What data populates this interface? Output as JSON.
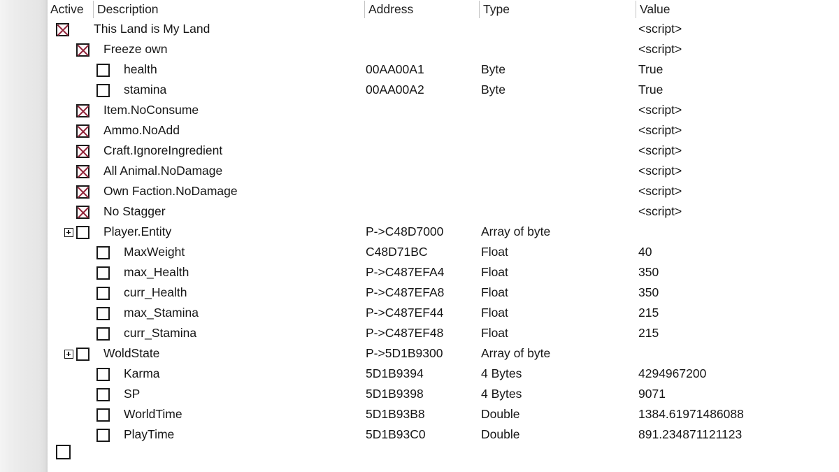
{
  "window": {
    "title": "Cheat Engine Table"
  },
  "columns": {
    "active": "Active",
    "description": "Description",
    "address": "Address",
    "type": "Type",
    "value": "Value"
  },
  "colors": {
    "check_mark": "#8e2036",
    "box_border": "#1a1a1a",
    "text": "#161616",
    "header_divider": "#c4c4c4",
    "background": "#ffffff",
    "gutter": "#e9e9e9"
  },
  "rows": [
    {
      "indent": 0,
      "checked": true,
      "expander": false,
      "description": "This Land is My Land",
      "address": "",
      "type": "",
      "value": "<script>"
    },
    {
      "indent": 1,
      "checked": true,
      "expander": false,
      "description": "Freeze own",
      "address": "",
      "type": "",
      "value": "<script>"
    },
    {
      "indent": 2,
      "checked": false,
      "expander": false,
      "description": "health",
      "address": "00AA00A1",
      "type": "Byte",
      "value": "True"
    },
    {
      "indent": 2,
      "checked": false,
      "expander": false,
      "description": "stamina",
      "address": "00AA00A2",
      "type": "Byte",
      "value": "True"
    },
    {
      "indent": 1,
      "checked": true,
      "expander": false,
      "description": "Item.NoConsume",
      "address": "",
      "type": "",
      "value": "<script>"
    },
    {
      "indent": 1,
      "checked": true,
      "expander": false,
      "description": "Ammo.NoAdd",
      "address": "",
      "type": "",
      "value": "<script>"
    },
    {
      "indent": 1,
      "checked": true,
      "expander": false,
      "description": "Craft.IgnoreIngredient",
      "address": "",
      "type": "",
      "value": "<script>"
    },
    {
      "indent": 1,
      "checked": true,
      "expander": false,
      "description": "All Animal.NoDamage",
      "address": "",
      "type": "",
      "value": "<script>"
    },
    {
      "indent": 1,
      "checked": true,
      "expander": false,
      "description": "Own Faction.NoDamage",
      "address": "",
      "type": "",
      "value": "<script>"
    },
    {
      "indent": 1,
      "checked": true,
      "expander": false,
      "description": "No Stagger",
      "address": "",
      "type": "",
      "value": "<script>"
    },
    {
      "indent": 1,
      "checked": false,
      "expander": true,
      "description": "Player.Entity",
      "address": "P->C48D7000",
      "type": "Array of byte",
      "value": ""
    },
    {
      "indent": 2,
      "checked": false,
      "expander": false,
      "description": "MaxWeight",
      "address": "C48D71BC",
      "type": "Float",
      "value": "40"
    },
    {
      "indent": 2,
      "checked": false,
      "expander": false,
      "description": "max_Health",
      "address": "P->C487EFA4",
      "type": "Float",
      "value": "350"
    },
    {
      "indent": 2,
      "checked": false,
      "expander": false,
      "description": "curr_Health",
      "address": "P->C487EFA8",
      "type": "Float",
      "value": "350"
    },
    {
      "indent": 2,
      "checked": false,
      "expander": false,
      "description": "max_Stamina",
      "address": "P->C487EF44",
      "type": "Float",
      "value": "215"
    },
    {
      "indent": 2,
      "checked": false,
      "expander": false,
      "description": "curr_Stamina",
      "address": "P->C487EF48",
      "type": "Float",
      "value": "215"
    },
    {
      "indent": 1,
      "checked": false,
      "expander": true,
      "description": "WoldState",
      "address": "P->5D1B9300",
      "type": "Array of byte",
      "value": ""
    },
    {
      "indent": 2,
      "checked": false,
      "expander": false,
      "description": "Karma",
      "address": "5D1B9394",
      "type": "4 Bytes",
      "value": "4294967200"
    },
    {
      "indent": 2,
      "checked": false,
      "expander": false,
      "description": "SP",
      "address": "5D1B9398",
      "type": "4 Bytes",
      "value": "9071"
    },
    {
      "indent": 2,
      "checked": false,
      "expander": false,
      "description": "WorldTime",
      "address": "5D1B93B8",
      "type": "Double",
      "value": "1384.61971486088"
    },
    {
      "indent": 2,
      "checked": false,
      "expander": false,
      "description": "PlayTime",
      "address": "5D1B93C0",
      "type": "Double",
      "value": "891.234871121123"
    }
  ],
  "new_entry_checkbox": {
    "checked": false
  }
}
